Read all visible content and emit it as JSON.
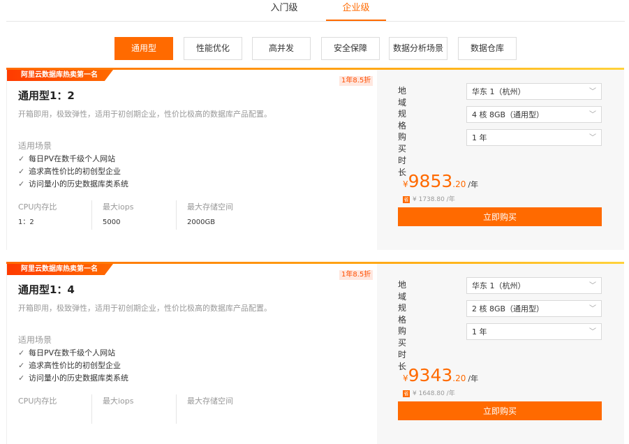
{
  "tiers": [
    "入门级",
    "企业级"
  ],
  "categories": [
    "通用型",
    "性能优化",
    "高并发",
    "安全保障",
    "数据分析场景",
    "数据仓库"
  ],
  "cards": [
    {
      "badge": "阿里云数据库热卖第一名",
      "discount": "1年8.5折",
      "title": "通用型1：2",
      "description": "开箱即用，极致弹性，适用于初创期企业，性价比极高的数据库产品配置。",
      "scenes_title": "适用场景",
      "scenes": [
        "每日PV在数千级个人网站",
        "追求高性价比的初创型企业",
        "访问量小的历史数据库类系统"
      ],
      "metrics": [
        {
          "label": "CPU内存比",
          "value": "1：2"
        },
        {
          "label": "最大iops",
          "value": "5000"
        },
        {
          "label": "最大存储空间",
          "value": "2000GB"
        }
      ],
      "options": [
        {
          "label": "地域",
          "value": "华东 1（杭州）"
        },
        {
          "label": "规格",
          "value": "4 核 8GB（通用型）"
        },
        {
          "label": "购买时长",
          "value": "1 年"
        }
      ],
      "price": {
        "currency": "¥",
        "amount": "9853",
        "decimal": ".20",
        "unit": "/年"
      },
      "original": "¥ 1738.80 /年",
      "buy": "立即购买"
    },
    {
      "badge": "阿里云数据库热卖第一名",
      "discount": "1年8.5折",
      "title": "通用型1：4",
      "description": "开箱即用，极致弹性，适用于初创期企业，性价比极高的数据库产品配置。",
      "scenes_title": "适用场景",
      "scenes": [
        "每日PV在数千级个人网站",
        "追求高性价比的初创型企业",
        "访问量小的历史数据库类系统"
      ],
      "metrics": [
        {
          "label": "CPU内存比",
          "value": ""
        },
        {
          "label": "最大iops",
          "value": ""
        },
        {
          "label": "最大存储空间",
          "value": ""
        }
      ],
      "options": [
        {
          "label": "地域",
          "value": "华东 1（杭州）"
        },
        {
          "label": "规格",
          "value": "2 核 8GB（通用型）"
        },
        {
          "label": "购买时长",
          "value": "1 年"
        }
      ],
      "price": {
        "currency": "¥",
        "amount": "9343",
        "decimal": ".20",
        "unit": "/年"
      },
      "original": "¥ 1648.80 /年",
      "buy": "立即购买"
    }
  ],
  "colors": {
    "accent": "#ff6a00",
    "panel": "#f7f7f7"
  }
}
